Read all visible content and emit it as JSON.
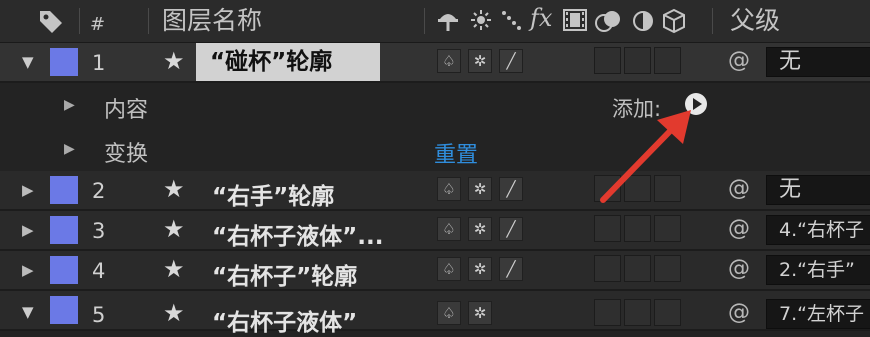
{
  "header": {
    "label_icon": "tag-icon",
    "hash": "#",
    "layer_name": "图层名称",
    "switch_icons": [
      "shy-icon",
      "sun-icon",
      "quality-icon",
      "fx-icon",
      "frame-blend-icon",
      "motion-blur-icon",
      "adjustment-icon",
      "3d-cube-icon"
    ],
    "parent": "父级"
  },
  "layers": [
    {
      "num": "1",
      "name": "“碰杯”轮廓",
      "expanded": true,
      "selected": true,
      "parent": "无",
      "color": "#6b79e6"
    },
    {
      "num": "2",
      "name": "“右手”轮廓",
      "expanded": false,
      "selected": false,
      "parent": "无",
      "color": "#6b79e6"
    },
    {
      "num": "3",
      "name": "“右杯子液体”...",
      "expanded": false,
      "selected": false,
      "parent": "4.“右杯子",
      "color": "#6b79e6"
    },
    {
      "num": "4",
      "name": "“右杯子”轮廓",
      "expanded": false,
      "selected": false,
      "parent": "2.“右手”",
      "color": "#6b79e6"
    },
    {
      "num": "5",
      "name": "“右杯子液体”",
      "expanded": false,
      "selected": false,
      "parent": "7.“左杯子",
      "color": "#6b79e6"
    }
  ],
  "properties": {
    "contents": "内容",
    "add": "添加:",
    "transform": "变换",
    "reset": "重置"
  },
  "colors": {
    "accent_link": "#2f8ddc",
    "arrow": "#e23a2e",
    "label": "#6b79e6"
  }
}
